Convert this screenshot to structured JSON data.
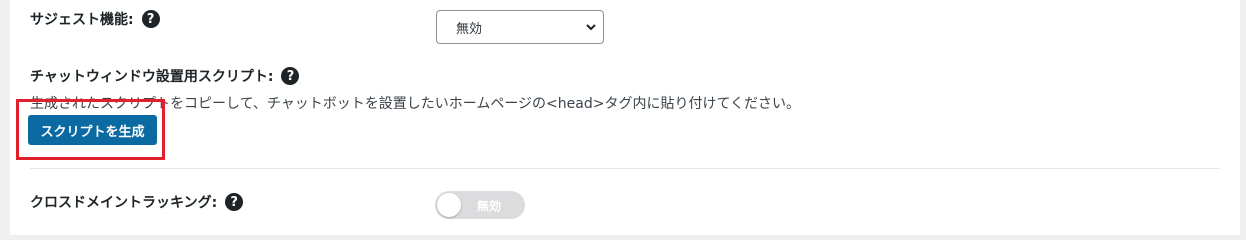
{
  "suggest": {
    "label": "サジェスト機能:",
    "select_value": "無効"
  },
  "script_section": {
    "label": "チャットウィンドウ設置用スクリプト:",
    "description": "生成されたスクリプトをコピーして、チャットボットを設置したいホームページの<head>タグ内に貼り付けてください。",
    "generate_button": "スクリプトを生成"
  },
  "cross_domain": {
    "label": "クロスドメイントラッキング:",
    "toggle_label": "無効"
  },
  "icons": {
    "help": "help-circle-icon",
    "chevron": "chevron-down-icon"
  },
  "colors": {
    "button_bg": "#0b6aa2",
    "highlight_border": "#e0202a",
    "toggle_off": "#dcdcde"
  }
}
